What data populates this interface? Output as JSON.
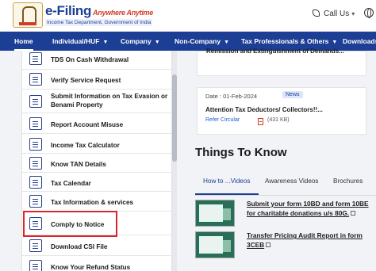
{
  "header": {
    "logo_title": "e-Filing",
    "logo_tagline": "Anywhere Anytime",
    "logo_subtitle": "Income Tax Department, Government of India",
    "call_us": "Call Us"
  },
  "nav": {
    "items": [
      {
        "label": "Home"
      },
      {
        "label": "Individual/HUF"
      },
      {
        "label": "Company"
      },
      {
        "label": "Non-Company"
      },
      {
        "label": "Tax Professionals & Others"
      },
      {
        "label": "Downloads"
      }
    ]
  },
  "sidebar": {
    "items": [
      {
        "label": "TDS On Cash Withdrawal"
      },
      {
        "label": "Verify Service Request"
      },
      {
        "label": "Submit Information on Tax Evasion or Benami Property"
      },
      {
        "label": "Report Account Misuse"
      },
      {
        "label": "Income Tax Calculator"
      },
      {
        "label": "Know TAN Details"
      },
      {
        "label": "Tax Calendar"
      },
      {
        "label": "Tax Information & services"
      },
      {
        "label": "Comply to Notice"
      },
      {
        "label": "Download CSI File"
      },
      {
        "label": "Know Your Refund Status"
      }
    ]
  },
  "news": {
    "card1_text": "Remission and Extinguishment of Demands...",
    "card2": {
      "date": "Date : 01-Feb-2024",
      "badge": "News",
      "title": "Attention Tax Deductors/ Collectors!!...",
      "link": "Refer Circular",
      "size": "(431 KB)"
    }
  },
  "things_to_know": {
    "title": "Things To Know",
    "tabs": [
      {
        "label": "How to ...Videos"
      },
      {
        "label": "Awareness Videos"
      },
      {
        "label": "Brochures"
      }
    ],
    "videos": [
      {
        "title": "Submit your form 10BD and form 10BE for charitable donations u/s 80G."
      },
      {
        "title": "Transfer Pricing Audit Report in form 3CEB"
      }
    ]
  },
  "colors": {
    "brand_blue": "#1c3f95",
    "highlight_red": "#d9262b"
  }
}
